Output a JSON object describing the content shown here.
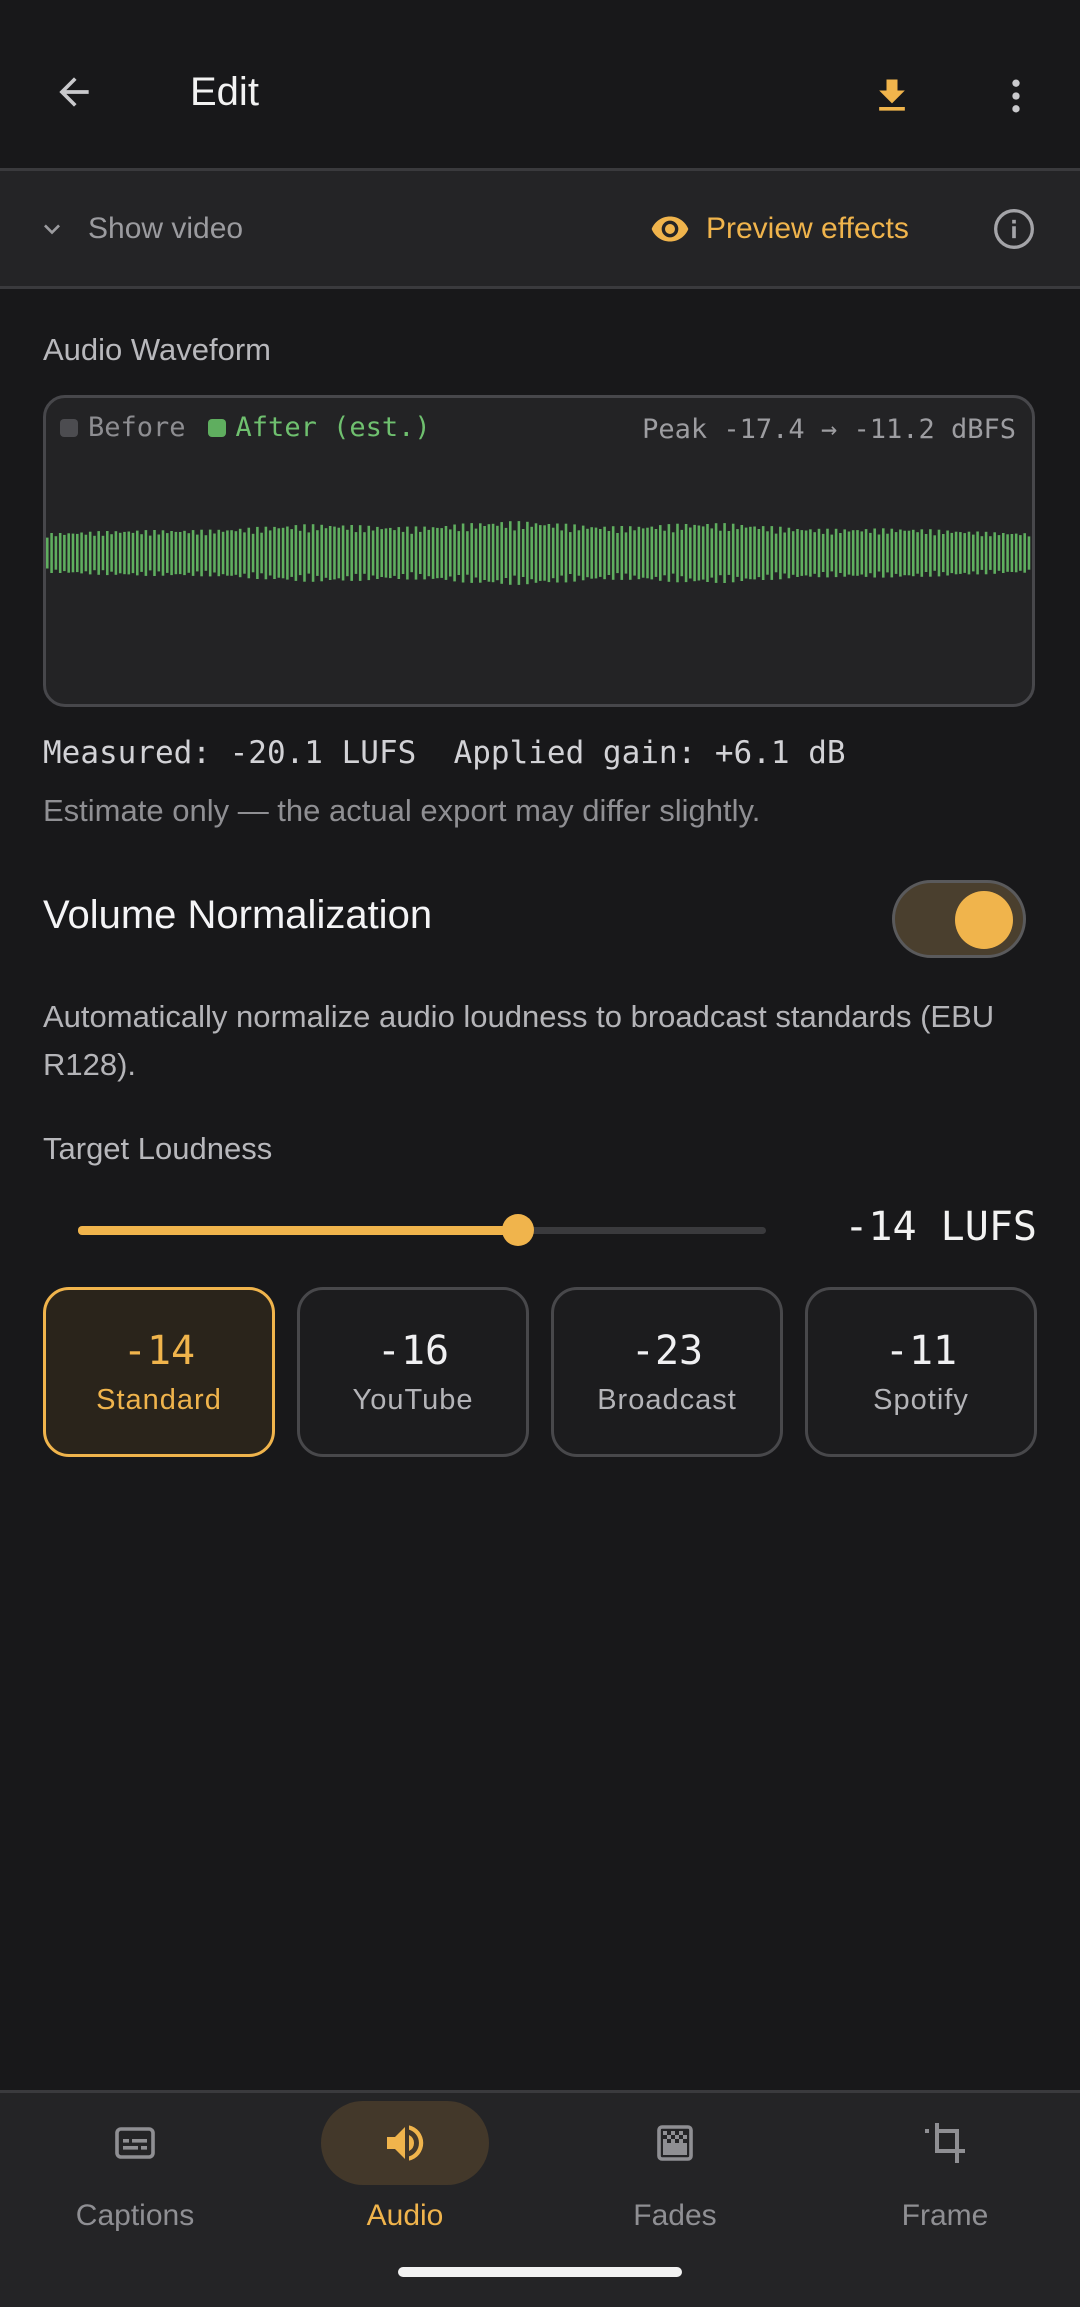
{
  "header": {
    "title": "Edit"
  },
  "subbar": {
    "show_video": "Show video",
    "preview": "Preview effects"
  },
  "waveform": {
    "label": "Audio Waveform",
    "legend_before": "Before",
    "legend_after": "After (est.)",
    "peak": "Peak -17.4 → -11.2 dBFS",
    "colors": {
      "after": "#5fae5f",
      "before": "#5a5a5e"
    }
  },
  "measured": "Measured: -20.1 LUFS  Applied gain: +6.1 dB",
  "estimate": "Estimate only — the actual export may differ slightly.",
  "normalization": {
    "title": "Volume Normalization",
    "enabled": true,
    "description": "Automatically normalize audio loudness to broadcast standards (EBU R128)."
  },
  "target": {
    "label": "Target Loudness",
    "value_text": "-14 LUFS",
    "slider_fraction": 0.64
  },
  "presets": [
    {
      "value": "-14",
      "name": "Standard",
      "active": true
    },
    {
      "value": "-16",
      "name": "YouTube",
      "active": false
    },
    {
      "value": "-23",
      "name": "Broadcast",
      "active": false
    },
    {
      "value": "-11",
      "name": "Spotify",
      "active": false
    }
  ],
  "nav": [
    {
      "label": "Captions",
      "icon": "captions-icon",
      "active": false
    },
    {
      "label": "Audio",
      "icon": "speaker-icon",
      "active": true
    },
    {
      "label": "Fades",
      "icon": "fades-icon",
      "active": false
    },
    {
      "label": "Frame",
      "icon": "crop-icon",
      "active": false
    }
  ],
  "colors": {
    "accent": "#f0b44c",
    "background": "#18181a"
  }
}
